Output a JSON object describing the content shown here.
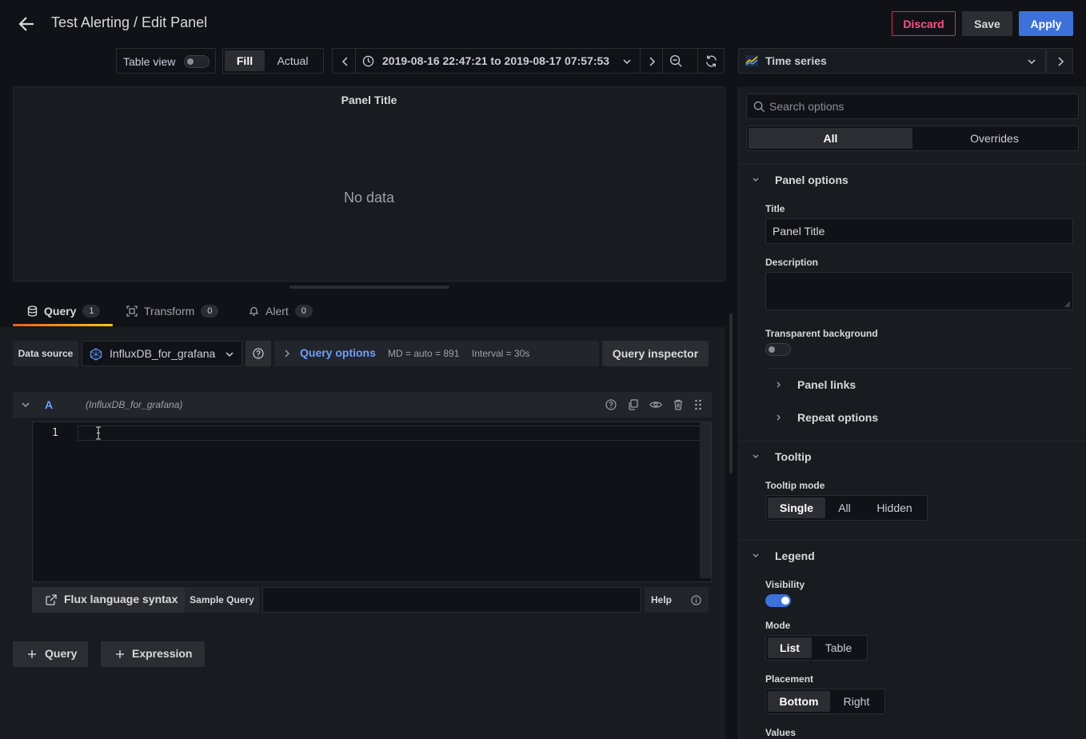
{
  "header": {
    "title": "Test Alerting / Edit Panel",
    "discard_label": "Discard",
    "save_label": "Save",
    "apply_label": "Apply"
  },
  "toolbar": {
    "table_view_label": "Table view",
    "fill_label": "Fill",
    "actual_label": "Actual",
    "time_range": "2019-08-16 22:47:21 to 2019-08-17 07:57:53",
    "visualization": "Time series"
  },
  "preview": {
    "panel_title": "Panel Title",
    "no_data": "No data"
  },
  "tabs": [
    {
      "label": "Query",
      "count": "1"
    },
    {
      "label": "Transform",
      "count": "0"
    },
    {
      "label": "Alert",
      "count": "0"
    }
  ],
  "query_bar": {
    "data_source_label": "Data source",
    "data_source_value": "InfluxDB_for_grafana",
    "query_options_label": "Query options",
    "md_info": "MD = auto = 891",
    "interval_info": "Interval = 30s",
    "query_inspector_label": "Query inspector"
  },
  "query_row": {
    "ref_id": "A",
    "datasource_name": "(InfluxDB_for_grafana)",
    "line_number": "1"
  },
  "editor_footer": {
    "flux_syntax_label": "Flux language syntax",
    "sample_query_label": "Sample Query",
    "help_label": "Help"
  },
  "add_buttons": {
    "query_label": "Query",
    "expression_label": "Expression"
  },
  "options": {
    "search_placeholder": "Search options",
    "all_label": "All",
    "overrides_label": "Overrides",
    "panel_options": {
      "title": "Panel options",
      "title_label": "Title",
      "title_value": "Panel Title",
      "description_label": "Description",
      "transparent_label": "Transparent background",
      "transparent_on": false,
      "panel_links_label": "Panel links",
      "repeat_options_label": "Repeat options"
    },
    "tooltip": {
      "title": "Tooltip",
      "mode_label": "Tooltip mode",
      "modes": [
        "Single",
        "All",
        "Hidden"
      ],
      "selected": "Single"
    },
    "legend": {
      "title": "Legend",
      "visibility_label": "Visibility",
      "visibility_on": true,
      "mode_label": "Mode",
      "modes": [
        "List",
        "Table"
      ],
      "mode_selected": "List",
      "placement_label": "Placement",
      "placements": [
        "Bottom",
        "Right"
      ],
      "placement_selected": "Bottom",
      "values_label": "Values"
    }
  },
  "colors": {
    "primary": "#3d71d9",
    "danger": "#e02f44",
    "tab_active": "#ff7733",
    "link_blue": "#6e9fff"
  }
}
